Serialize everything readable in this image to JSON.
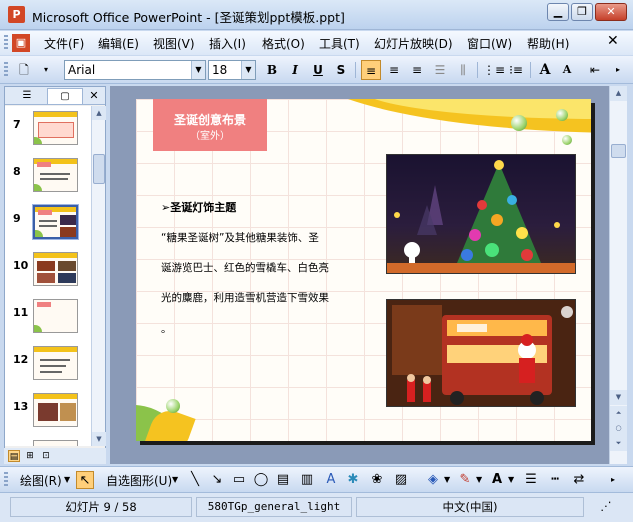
{
  "window": {
    "title": "Microsoft Office PowerPoint - [圣诞策划ppt模板.ppt]",
    "app_icon": "P"
  },
  "menu": {
    "items": [
      "文件(F)",
      "编辑(E)",
      "视图(V)",
      "插入(I)",
      "格式(O)",
      "工具(T)",
      "幻灯片放映(D)",
      "窗口(W)",
      "帮助(H)"
    ]
  },
  "toolbar": {
    "font_name": "Arial",
    "font_size": "18",
    "bold": "B",
    "italic": "I",
    "underline": "U",
    "shadow": "S",
    "grow_font": "A",
    "shrink_font": "A"
  },
  "slides_panel": {
    "numbers": [
      "7",
      "8",
      "9",
      "10",
      "11",
      "12",
      "13"
    ],
    "selected_index": 2
  },
  "slide": {
    "title": "圣诞创意布景",
    "subtitle": "（室外）",
    "heading": "➢圣诞灯饰主题",
    "lines": [
      "“糖果圣诞树”及其他糖果装饰、圣",
      "诞游览巴士、红色的雪橇车、白色亮",
      "光的麋鹿，利用造雪机营造下雪效果",
      "。"
    ]
  },
  "drawing_toolbar": {
    "draw": "绘图(R)",
    "autoshapes": "自选图形(U)"
  },
  "status": {
    "slide_info": "幻灯片 9 / 58",
    "design": "580TGp_general_light",
    "language": "中文(中国)"
  },
  "colors": {
    "title_box": "#f08080",
    "gold": "#f5c320",
    "leaf": "#8bc34a"
  }
}
